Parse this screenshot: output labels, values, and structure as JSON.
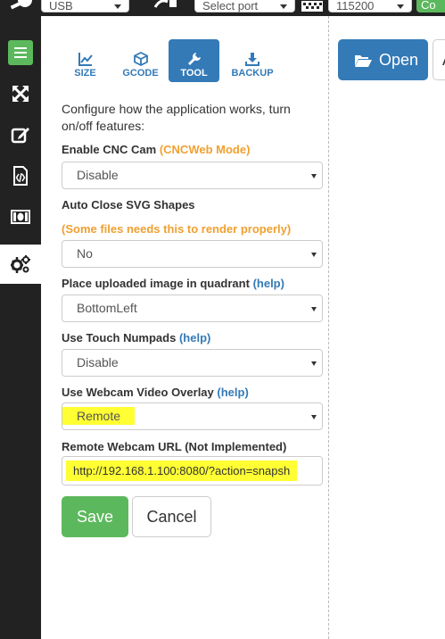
{
  "topbar": {
    "connection_select": "USB",
    "port_select": "Select port",
    "baud_select": "115200",
    "connect_button": "Co"
  },
  "sidebar": {
    "items": [
      {
        "icon": "menu-icon"
      },
      {
        "icon": "expand-icon"
      },
      {
        "icon": "edit-icon"
      },
      {
        "icon": "file-code-icon"
      },
      {
        "icon": "money-icon"
      },
      {
        "icon": "cogs-icon",
        "active": true
      }
    ]
  },
  "tabs": [
    {
      "label": "SIZE",
      "icon": "chart-icon"
    },
    {
      "label": "GCODE",
      "icon": "cube-icon"
    },
    {
      "label": "TOOL",
      "icon": "wrench-icon",
      "active": true
    },
    {
      "label": "BACKUP",
      "icon": "download-icon"
    }
  ],
  "intro": "Configure how the application works, turn on/off features:",
  "settings": {
    "cnc_cam": {
      "label": "Enable CNC Cam",
      "note": "(CNCWeb Mode)",
      "value": "Disable"
    },
    "auto_close": {
      "label": "Auto Close SVG Shapes",
      "note": "(Some files needs this to render properly)",
      "value": "No"
    },
    "quadrant": {
      "label": "Place uploaded image in quadrant",
      "help": "(help)",
      "value": "BottomLeft"
    },
    "numpads": {
      "label": "Use Touch Numpads",
      "help": "(help)",
      "value": "Disable"
    },
    "webcam_overlay": {
      "label": "Use Webcam Video Overlay",
      "help": "(help)",
      "value": "Remote"
    },
    "webcam_url": {
      "label": "Remote Webcam URL (Not Implemented)",
      "value": "http://192.168.1.100:8080/?action=snapsh"
    }
  },
  "buttons": {
    "save": "Save",
    "cancel": "Cancel",
    "open": "Open",
    "partial": "A"
  }
}
